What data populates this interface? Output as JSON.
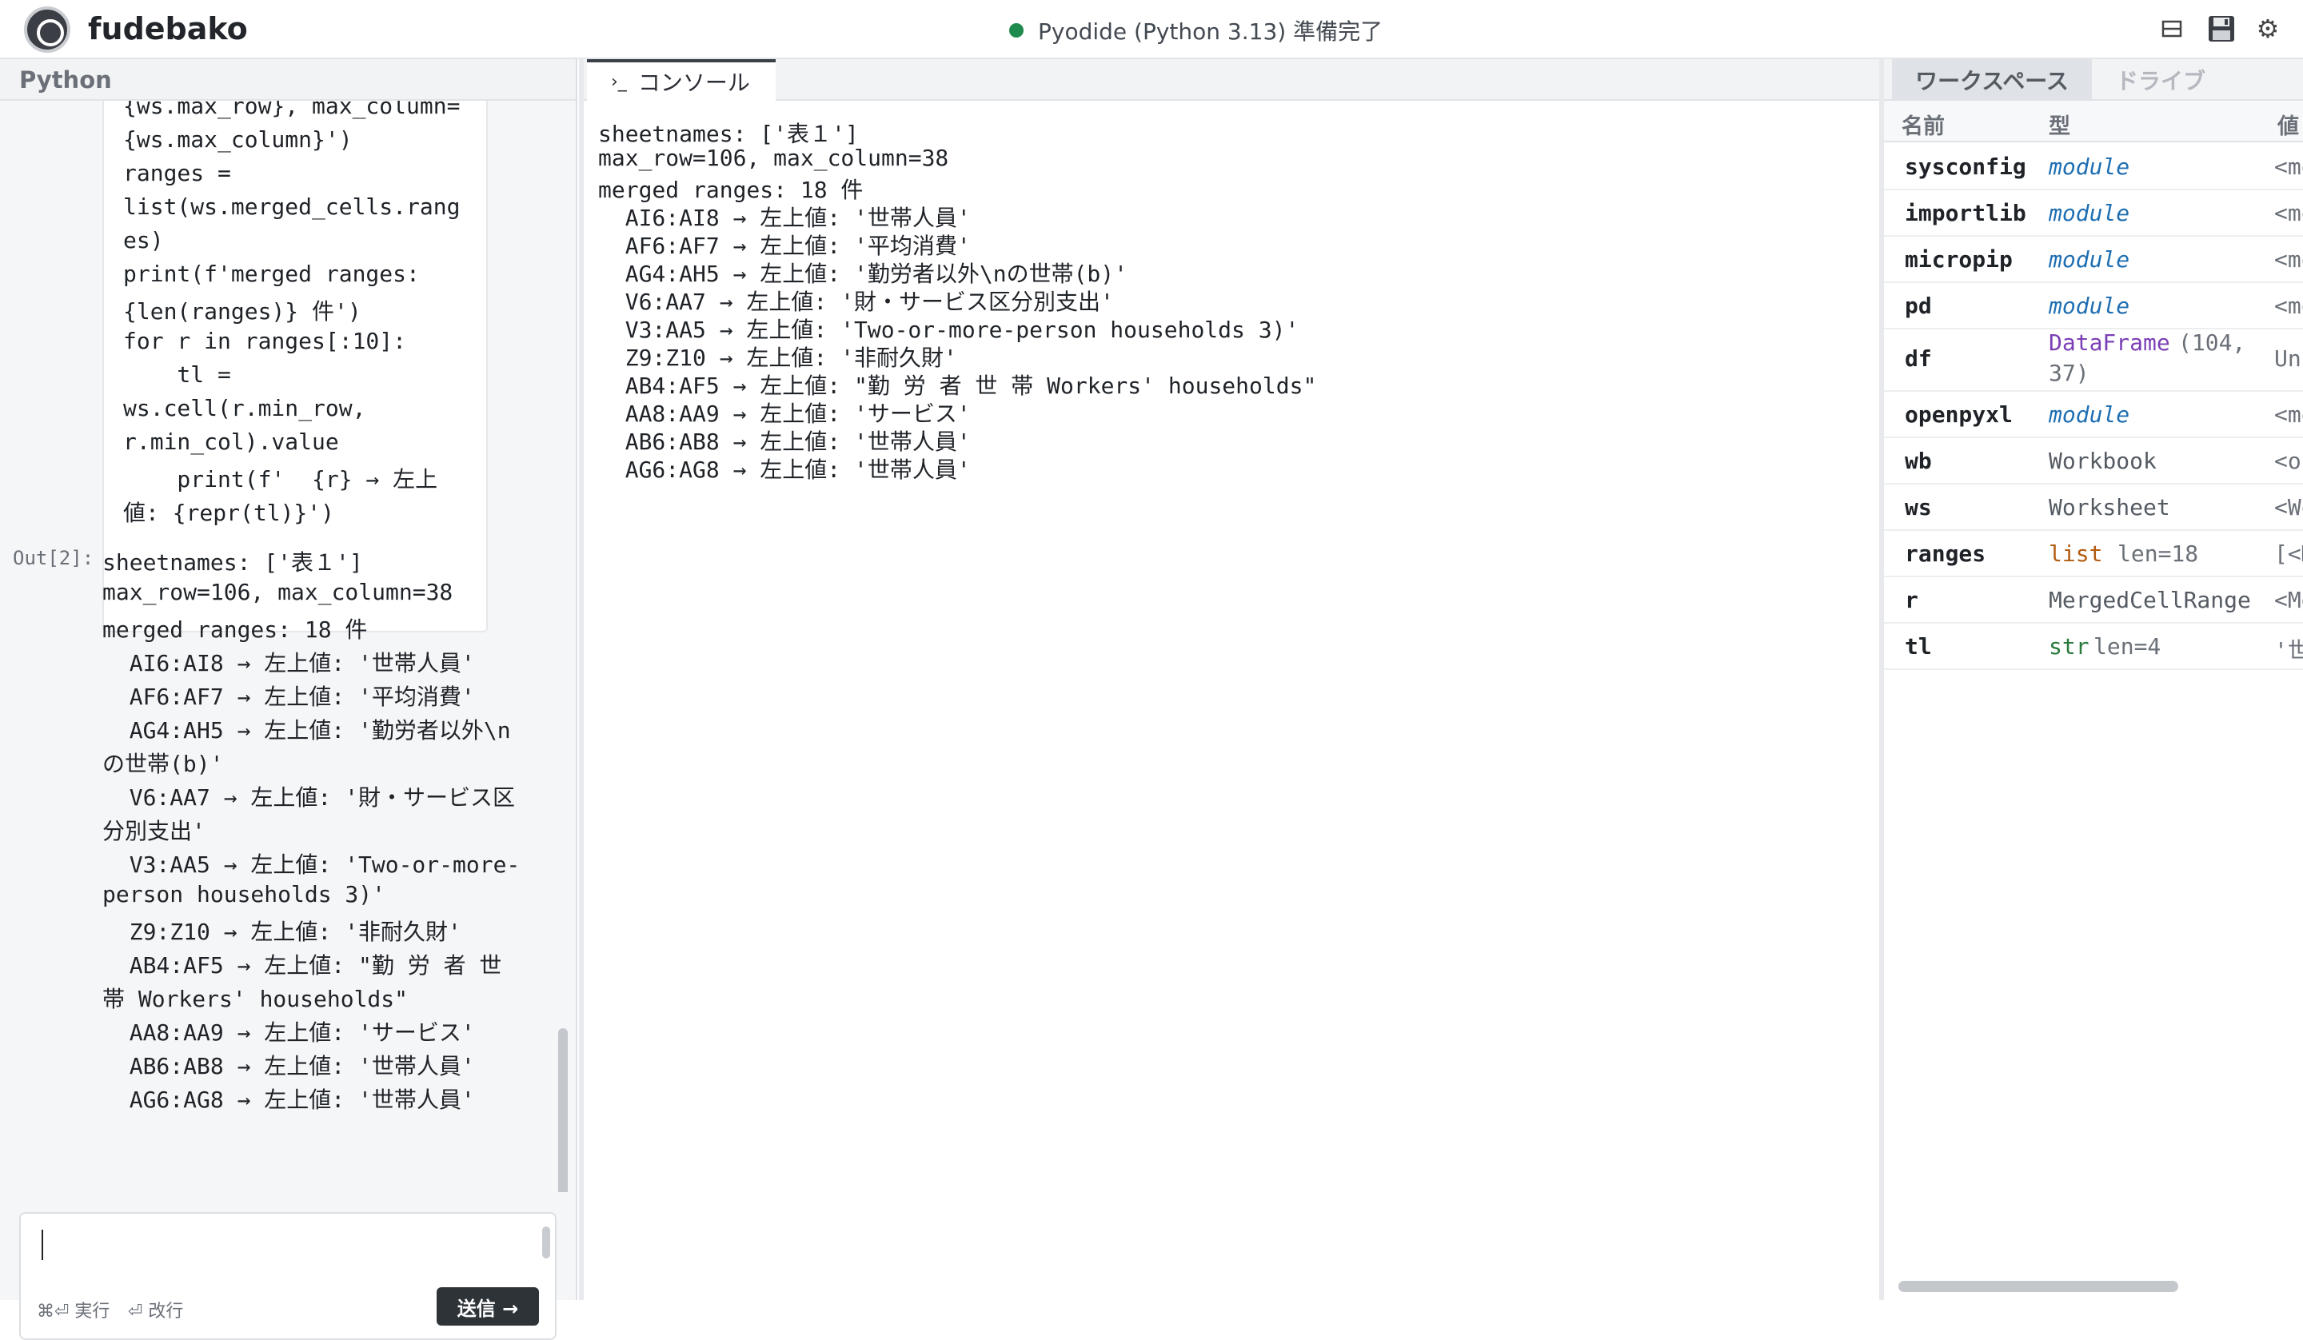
{
  "app": {
    "title": "fudebako",
    "status": "Pyodide (Python 3.13) 準備完了"
  },
  "topbar_icons": [
    "layout-toggle-icon",
    "save-icon",
    "settings-gear-icon"
  ],
  "left_panel": {
    "header": "Python",
    "code_lines": [
      "{ws.max_row}, max_column=",
      "{ws.max_column}')",
      "ranges =",
      "list(ws.merged_cells.rang",
      "es)",
      "print(f'merged ranges:",
      "{len(ranges)} 件')",
      "for r in ranges[:10]:",
      "    tl =",
      "ws.cell(r.min_row,",
      "r.min_col).value",
      "    print(f'  {r} → 左上",
      "値: {repr(tl)}')"
    ],
    "out_label": "Out[2]:",
    "output_lines": [
      "sheetnames: ['表１']",
      "max_row=106, max_column=38",
      "merged ranges: 18 件",
      "  AI6:AI8 → 左上値: '世帯人員'",
      "  AF6:AF7 → 左上値: '平均消費'",
      "  AG4:AH5 → 左上値: '勤労者以外\\n",
      "の世帯(b)'",
      "  V6:AA7 → 左上値: '財・サービス区",
      "分別支出'",
      "  V3:AA5 → 左上値: 'Two-or-more-",
      "person households 3)'",
      "  Z9:Z10 → 左上値: '非耐久財'",
      "  AB4:AF5 → 左上値: \"勤 労 者 世",
      "帯 Workers' households\"",
      "  AA8:AA9 → 左上値: 'サービス'",
      "  AB6:AB8 → 左上値: '世帯人員'",
      "  AG6:AG8 → 左上値: '世帯人員'"
    ],
    "input": {
      "value": "",
      "hint_run": "⌘⏎ 実行",
      "hint_newline": "⏎ 改行",
      "send_label": "送信 →"
    }
  },
  "console": {
    "tab_label": "コンソール",
    "tab_icon": "terminal-prompt-icon",
    "lines": [
      "sheetnames: ['表１']",
      "max_row=106, max_column=38",
      "merged ranges: 18 件",
      "  AI6:AI8 → 左上値: '世帯人員'",
      "  AF6:AF7 → 左上値: '平均消費'",
      "  AG4:AH5 → 左上値: '勤労者以外\\nの世帯(b)'",
      "  V6:AA7 → 左上値: '財・サービス区分別支出'",
      "  V3:AA5 → 左上値: 'Two-or-more-person households 3)'",
      "  Z9:Z10 → 左上値: '非耐久財'",
      "  AB4:AF5 → 左上値: \"勤 労 者 世 帯 Workers' households\"",
      "  AA8:AA9 → 左上値: 'サービス'",
      "  AB6:AB8 → 左上値: '世帯人員'",
      "  AG6:AG8 → 左上値: '世帯人員'"
    ]
  },
  "workspace": {
    "tabs": [
      "ワークスペース",
      "ドライブ"
    ],
    "columns": [
      "名前",
      "型",
      "値"
    ],
    "rows": [
      {
        "name": "sysconfig",
        "type": "module",
        "type_extra": "",
        "value": "<mo",
        "kind": "module"
      },
      {
        "name": "importlib",
        "type": "module",
        "type_extra": "",
        "value": "<mo",
        "kind": "module"
      },
      {
        "name": "micropip",
        "type": "module",
        "type_extra": "",
        "value": "<mo",
        "kind": "module"
      },
      {
        "name": "pd",
        "type": "module",
        "type_extra": "",
        "value": "<mo",
        "kind": "module"
      },
      {
        "name": "df",
        "type": "DataFrame",
        "type_extra": "(104,",
        "type_extra2": "37)",
        "value": "Un",
        "kind": "dataframe"
      },
      {
        "name": "openpyxl",
        "type": "module",
        "type_extra": "",
        "value": "<mo",
        "kind": "module"
      },
      {
        "name": "wb",
        "type": "Workbook",
        "type_extra": "",
        "value": "<op",
        "kind": "plain"
      },
      {
        "name": "ws",
        "type": "Worksheet",
        "type_extra": "",
        "value": "<Wo",
        "kind": "plain"
      },
      {
        "name": "ranges",
        "type": "list",
        "type_extra": "len=18",
        "value": "[<M",
        "kind": "list"
      },
      {
        "name": "r",
        "type": "MergedCellRange",
        "type_extra": "",
        "value": "<Me",
        "kind": "plain"
      },
      {
        "name": "tl",
        "type": "str",
        "type_extra": "len=4",
        "value": "'世",
        "kind": "str"
      }
    ],
    "type_colors": {
      "module": "#1f6fb2",
      "dataframe": "#7b3fb5",
      "plain": "#555b63",
      "list": "#b35c12",
      "str": "#2b7a3d"
    }
  }
}
